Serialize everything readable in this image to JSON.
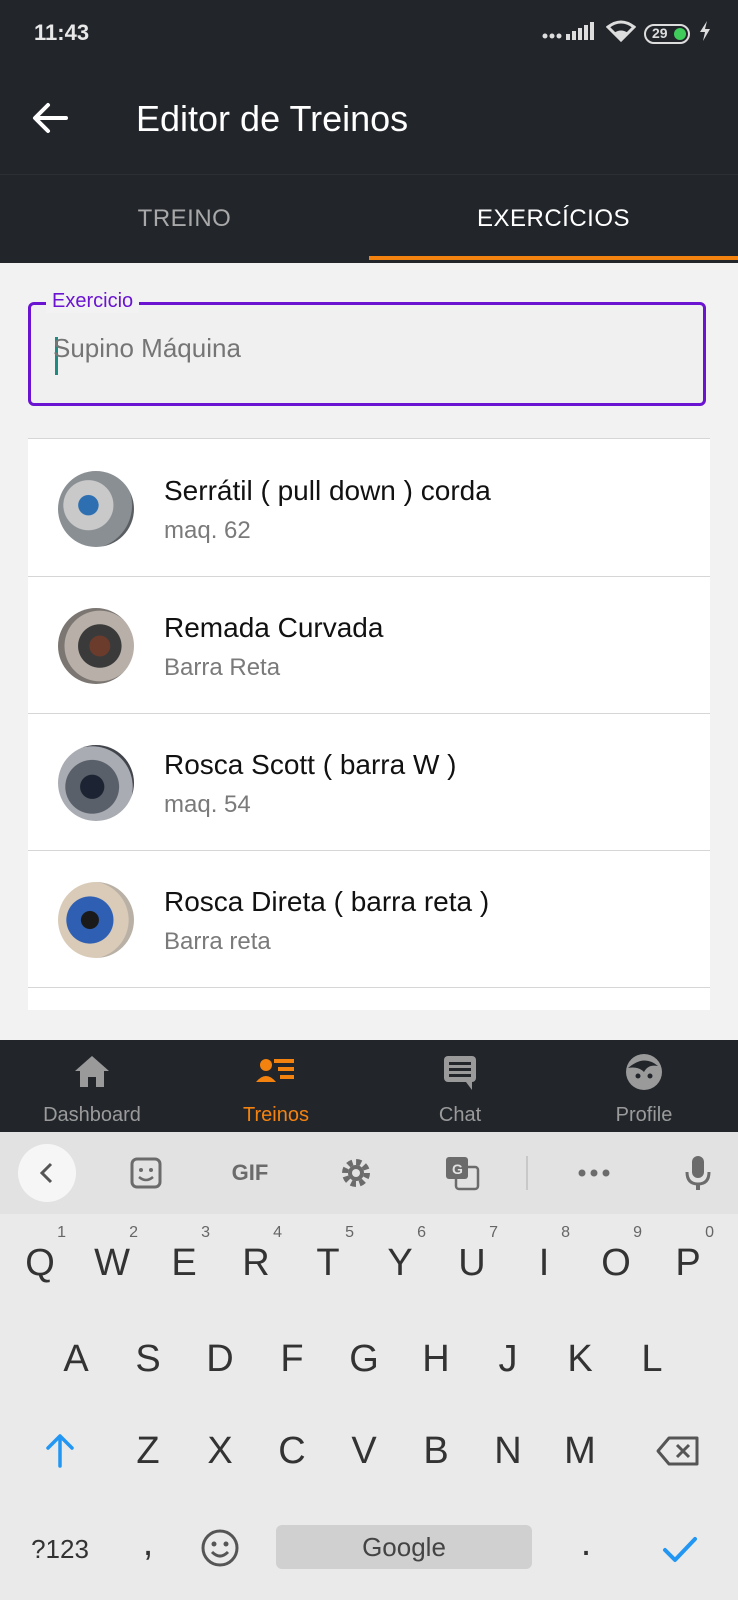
{
  "status_bar": {
    "time": "11:43",
    "battery": "29"
  },
  "app_bar": {
    "title": "Editor de Treinos"
  },
  "tabs": [
    {
      "label": "TREINO",
      "active": false
    },
    {
      "label": "EXERCÍCIOS",
      "active": true
    }
  ],
  "search": {
    "label": "Exercicio",
    "placeholder": "Supino Máquina",
    "value": ""
  },
  "exercises": [
    {
      "name": "Serrátil ( pull down ) corda",
      "detail": "maq. 62"
    },
    {
      "name": "Remada Curvada",
      "detail": "Barra Reta"
    },
    {
      "name": "Rosca Scott ( barra W )",
      "detail": "maq. 54"
    },
    {
      "name": "Rosca Direta ( barra reta )",
      "detail": "Barra reta"
    }
  ],
  "bottom_nav": [
    {
      "label": "Dashboard",
      "icon": "home-icon",
      "active": false
    },
    {
      "label": "Treinos",
      "icon": "list-user-icon",
      "active": true
    },
    {
      "label": "Chat",
      "icon": "chat-icon",
      "active": false
    },
    {
      "label": "Profile",
      "icon": "face-icon",
      "active": false
    }
  ],
  "keyboard": {
    "toolbar": {
      "gif": "GIF"
    },
    "row1": [
      "Q",
      "W",
      "E",
      "R",
      "T",
      "Y",
      "U",
      "I",
      "O",
      "P"
    ],
    "row1_hints": [
      "1",
      "2",
      "3",
      "4",
      "5",
      "6",
      "7",
      "8",
      "9",
      "0"
    ],
    "row2": [
      "A",
      "S",
      "D",
      "F",
      "G",
      "H",
      "J",
      "K",
      "L"
    ],
    "row3": [
      "Z",
      "X",
      "C",
      "V",
      "B",
      "N",
      "M"
    ],
    "bottom": {
      "symbols": "?123",
      "comma": ",",
      "space": "Google",
      "period": "."
    }
  },
  "colors": {
    "accent": "#f4820f",
    "field_border": "#6a14d1",
    "bar": "#22262b"
  }
}
